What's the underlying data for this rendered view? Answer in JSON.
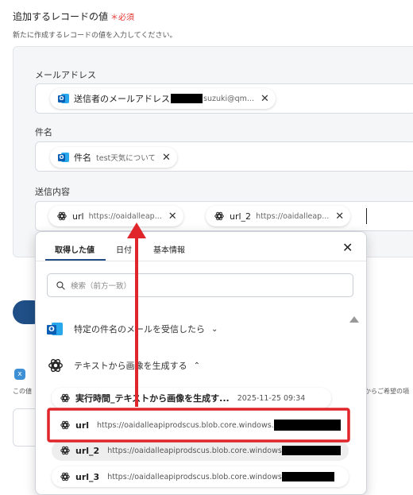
{
  "header": {
    "title": "追加するレコードの値",
    "required_mark": "＊必須",
    "subtitle": "新たに作成するレコードの値を入力してください。"
  },
  "fields": [
    {
      "label": "メールアドレス",
      "chips": [
        {
          "name": "送信者のメールアドレス",
          "value": "suzuki@qm..."
        }
      ]
    },
    {
      "label": "件名",
      "chips": [
        {
          "name": "件名",
          "value": "test天気について"
        }
      ]
    },
    {
      "label": "送信内容",
      "chips": [
        {
          "name": "url",
          "value": "https://oaidalleap..."
        },
        {
          "name": "url_2",
          "value": "https://oaidalleap..."
        }
      ]
    }
  ],
  "background_peek": {
    "left_text": "この値",
    "right_text": "からご希望の項"
  },
  "dropdown": {
    "tabs": [
      "取得した値",
      "日付",
      "基本情報"
    ],
    "active_tab": 0,
    "search_placeholder": "検索（前方一致）",
    "groups": [
      {
        "label": "特定の件名のメールを受信したら",
        "expanded": false
      },
      {
        "label": "テキストから画像を生成する",
        "expanded": true
      }
    ],
    "items": [
      {
        "name": "実行時間_テキストから画像を生成す...",
        "value": "2025-11-25 09:34"
      },
      {
        "name": "url",
        "value": "https://oaidalleapiprodscus.blob.core.windows."
      },
      {
        "name": "url_2",
        "value": "https://oaidalleapiprodscus.blob.core.windows"
      },
      {
        "name": "url_3",
        "value": "https://oaidalleapiprodscus.blob.core.windows"
      }
    ]
  },
  "colors": {
    "required": "#e4342d",
    "annotation": "#e0262b",
    "tab_active": "#1f4f86",
    "outlook": "#0a5fb4"
  }
}
